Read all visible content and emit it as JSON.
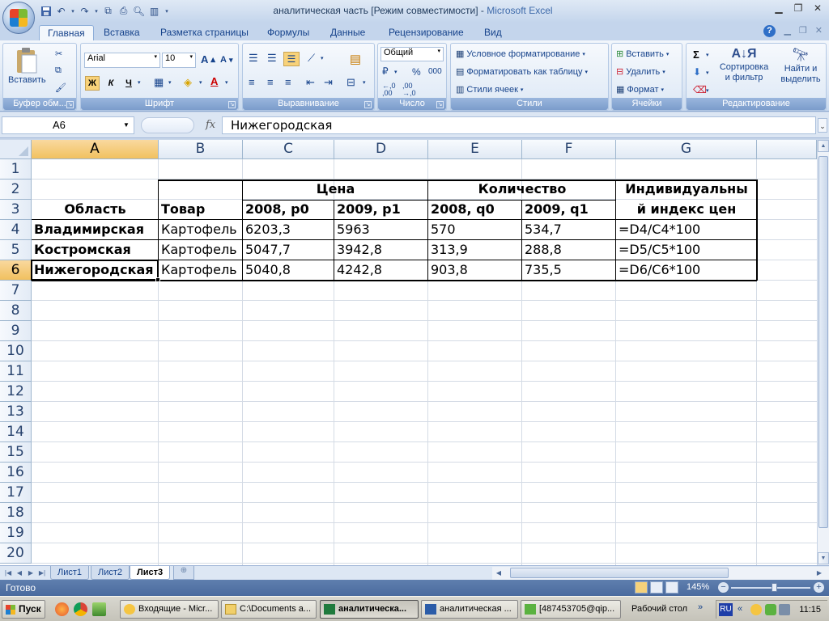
{
  "window": {
    "title_doc": "аналитическая часть  [Режим совместимости] - ",
    "title_app": "Microsoft Excel"
  },
  "ribbon_tabs": [
    "Главная",
    "Вставка",
    "Разметка страницы",
    "Формулы",
    "Данные",
    "Рецензирование",
    "Вид"
  ],
  "ribbon": {
    "clipboard": {
      "label": "Буфер обм...",
      "paste": "Вставить"
    },
    "font": {
      "label": "Шрифт",
      "name": "Arial",
      "size": "10",
      "bold": "Ж",
      "italic": "К",
      "underline": "Ч"
    },
    "alignment": {
      "label": "Выравнивание"
    },
    "number": {
      "label": "Число",
      "format": "Общий",
      "percent": "%",
      "thousands": "000"
    },
    "styles": {
      "label": "Стили",
      "conditional": "Условное форматирование",
      "as_table": "Форматировать как таблицу",
      "cell_styles": "Стили ячеек"
    },
    "cells": {
      "label": "Ячейки",
      "insert": "Вставить",
      "delete": "Удалить",
      "format": "Формат"
    },
    "editing": {
      "label": "Редактирование",
      "sort_line1": "Сортировка",
      "sort_line2": "и фильтр",
      "find_line1": "Найти и",
      "find_line2": "выделить"
    }
  },
  "formula_bar": {
    "name_box": "A6",
    "fx": "fx",
    "formula": "Нижегородская"
  },
  "columns": [
    "A",
    "B",
    "C",
    "D",
    "E",
    "F",
    "G"
  ],
  "rows": [
    "1",
    "2",
    "3",
    "4",
    "5",
    "6",
    "7",
    "8",
    "9",
    "10",
    "11",
    "12",
    "13",
    "14",
    "15",
    "16",
    "17",
    "18",
    "19",
    "20"
  ],
  "selected_cell": {
    "column": "A",
    "row": "6"
  },
  "cells": {
    "C2": "Цена",
    "E2": "Количество",
    "G2": "Индивидуальны",
    "A3": "Область",
    "B3": "Товар",
    "C3": "2008, p0",
    "D3": "2009,  p1",
    "E3": "2008,  q0",
    "F3": "2009,  q1",
    "G3": "й индекс цен",
    "A4": "Владимирская",
    "B4": "Картофель",
    "C4": "6203,3",
    "D4": "5963",
    "E4": "570",
    "F4": "534,7",
    "G4": "=D4/C4*100",
    "A5": "Костромская",
    "B5": "Картофель",
    "C5": "5047,7",
    "D5": "3942,8",
    "E5": "313,9",
    "F5": "288,8",
    "G5": "=D5/C5*100",
    "A6": "Нижегородская",
    "B6": "Картофель",
    "C6": "5040,8",
    "D6": "4242,8",
    "E6": "903,8",
    "F6": "735,5",
    "G6": "=D6/C6*100"
  },
  "sheets": [
    "Лист1",
    "Лист2",
    "Лист3"
  ],
  "active_sheet": "Лист3",
  "status": {
    "text": "Готово",
    "zoom": "145%"
  },
  "taskbar": {
    "start": "Пуск",
    "tasks": [
      "Входящие - Micr...",
      "C:\\Documents a...",
      "аналитическа...",
      "аналитическая ...",
      "[487453705@qip..."
    ],
    "active_task": "аналитическа...",
    "desktop": "Рабочий стол",
    "lang": "RU",
    "clock": "11:15"
  }
}
